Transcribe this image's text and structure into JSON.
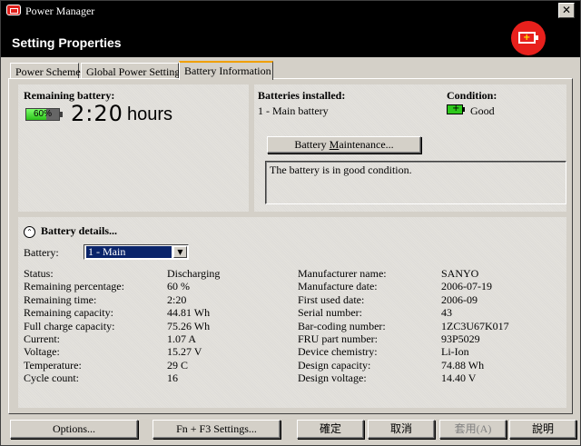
{
  "window": {
    "title": "Power Manager",
    "close_glyph": "✕"
  },
  "header": {
    "title": "Setting Properties",
    "brand_icon": "battery-charge-icon",
    "brand_color": "#e8201c"
  },
  "tabs": [
    {
      "label": "Power Scheme",
      "active": false
    },
    {
      "label": "Global Power Settings",
      "active": false
    },
    {
      "label": "Battery Information",
      "active": true
    }
  ],
  "remaining": {
    "label": "Remaining battery:",
    "percent_text": "60%",
    "percent_value": 60,
    "time": "2:20",
    "unit": "hours"
  },
  "installed": {
    "label": "Batteries installed:",
    "value": "1 - Main battery",
    "condition_label": "Condition:",
    "condition_value": "Good",
    "condition_color": "#2ec81c",
    "maintenance_button_prefix": "Battery ",
    "maintenance_button_mnemonic": "M",
    "maintenance_button_suffix": "aintenance...",
    "message": "The battery is in good condition."
  },
  "details": {
    "title": "Battery details...",
    "battery_label": "Battery:",
    "battery_selected": "1 - Main",
    "left": [
      {
        "label": "Status:",
        "value": "Discharging"
      },
      {
        "label": "Remaining percentage:",
        "value": "60 %"
      },
      {
        "label": "Remaining time:",
        "value": "2:20"
      },
      {
        "label": "Remaining capacity:",
        "value": "44.81 Wh"
      },
      {
        "label": "Full charge capacity:",
        "value": "75.26 Wh"
      },
      {
        "label": "Current:",
        "value": "1.07 A"
      },
      {
        "label": "Voltage:",
        "value": "15.27 V"
      },
      {
        "label": "Temperature:",
        "value": "29 C"
      },
      {
        "label": "Cycle count:",
        "value": "16"
      }
    ],
    "right": [
      {
        "label": "Manufacturer name:",
        "value": "SANYO"
      },
      {
        "label": "Manufacture date:",
        "value": "2006-07-19"
      },
      {
        "label": "First used date:",
        "value": "2006-09"
      },
      {
        "label": "Serial number:",
        "value": "43"
      },
      {
        "label": "Bar-coding number:",
        "value": "1ZC3U67K017"
      },
      {
        "label": "FRU part number:",
        "value": "93P5029"
      },
      {
        "label": "Device chemistry:",
        "value": "Li-Ion"
      },
      {
        "label": "Design capacity:",
        "value": "74.88 Wh"
      },
      {
        "label": "Design voltage:",
        "value": "14.40 V"
      }
    ]
  },
  "footer": {
    "options": "Options...",
    "fn_settings": "Fn + F3 Settings...",
    "ok": "確定",
    "cancel": "取消",
    "apply": "套用(A)",
    "help": "說明"
  }
}
